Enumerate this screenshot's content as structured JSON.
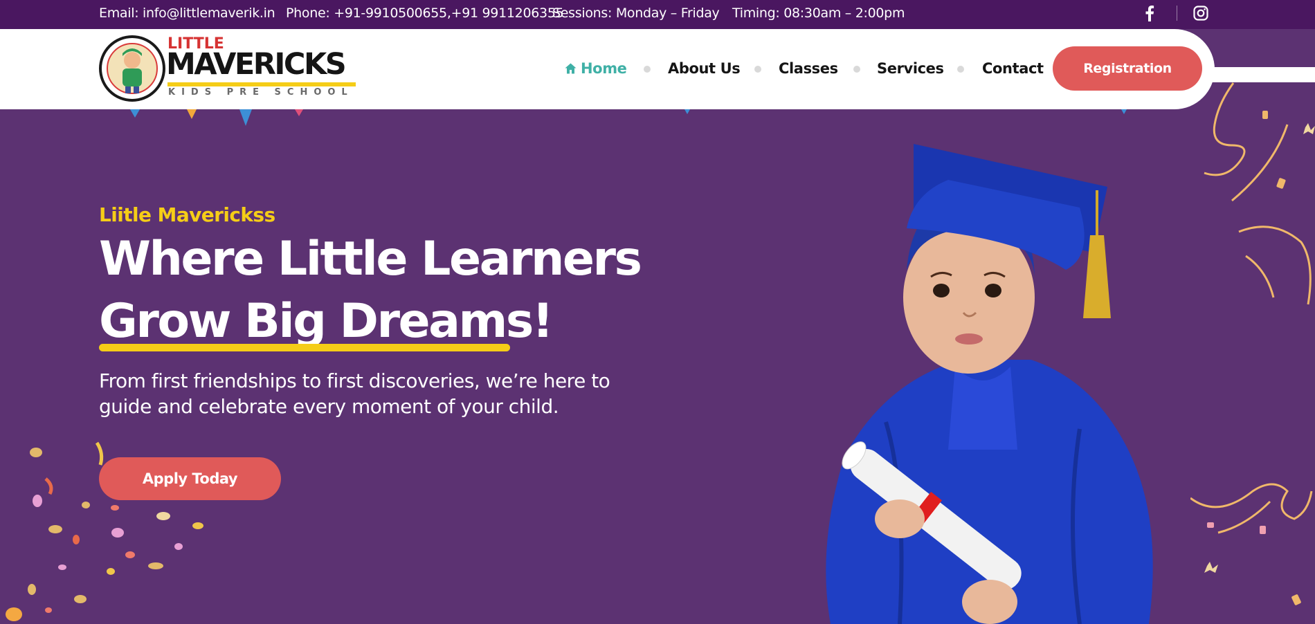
{
  "topbar": {
    "email": "Email: info@littlemaverik.in",
    "phone": "Phone: +91-9910500655,+91 9911206355",
    "sessions": "Sessions: Monday – Friday",
    "timing": "Timing: 08:30am – 2:00pm",
    "social": [
      "facebook-icon",
      "instagram-icon"
    ]
  },
  "logo": {
    "word1": "LITTLE",
    "word2": "MAVERICKS",
    "tagline": "KIDS PRE SCHOOL",
    "badge": "LITTLE MAVERICKS"
  },
  "nav": {
    "items": [
      {
        "label": "Home",
        "icon": "home-icon",
        "active": true
      },
      {
        "label": "About Us"
      },
      {
        "label": "Classes"
      },
      {
        "label": "Services"
      },
      {
        "label": "Contact"
      }
    ],
    "cta": "Registration"
  },
  "hero": {
    "eyebrow": "Liitle Maverickss",
    "line1": "Where Little Learners",
    "line2": "Grow Big Dreams!",
    "subtitle": "From first friendships to first discoveries, we’re here to guide and celebrate every moment of your child.",
    "cta": "Apply Today"
  },
  "colors": {
    "topbar_bg": "#4a1760",
    "hero_bg": "#5c3272",
    "accent_yellow": "#f5cd17",
    "accent_coral": "#e05a59",
    "nav_active": "#3fb0a6"
  }
}
